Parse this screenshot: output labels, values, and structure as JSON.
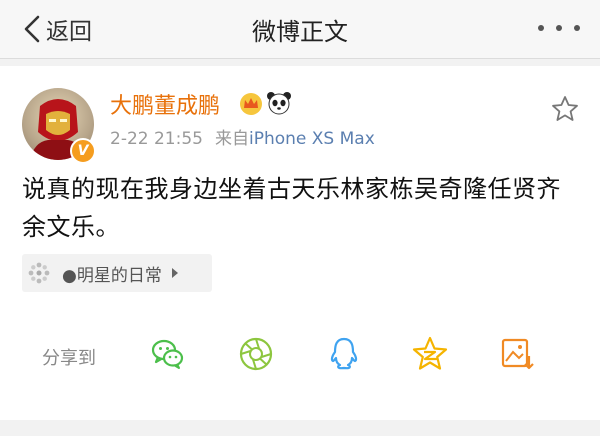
{
  "nav": {
    "back_label": "返回",
    "title": "微博正文"
  },
  "post": {
    "username": "大鹏董成鹏",
    "badge": "V",
    "time": "2-22 21:55",
    "source_prefix": "来自",
    "source": "iPhone XS Max",
    "content": "说真的现在我身边坐着古天乐林家栋吴奇隆任贤齐余文乐。",
    "topic": "●明星的日常"
  },
  "share": {
    "label": "分享到",
    "targets": [
      "wechat-icon",
      "moments-icon",
      "qq-icon",
      "qzone-icon",
      "save-image-icon"
    ]
  },
  "colors": {
    "username": "#e8710a",
    "share_green": "#4cbf4b",
    "share_lime": "#8dc63f",
    "share_blue": "#3fa3f0",
    "share_yellow": "#f5b400",
    "share_orange": "#f08a24"
  }
}
